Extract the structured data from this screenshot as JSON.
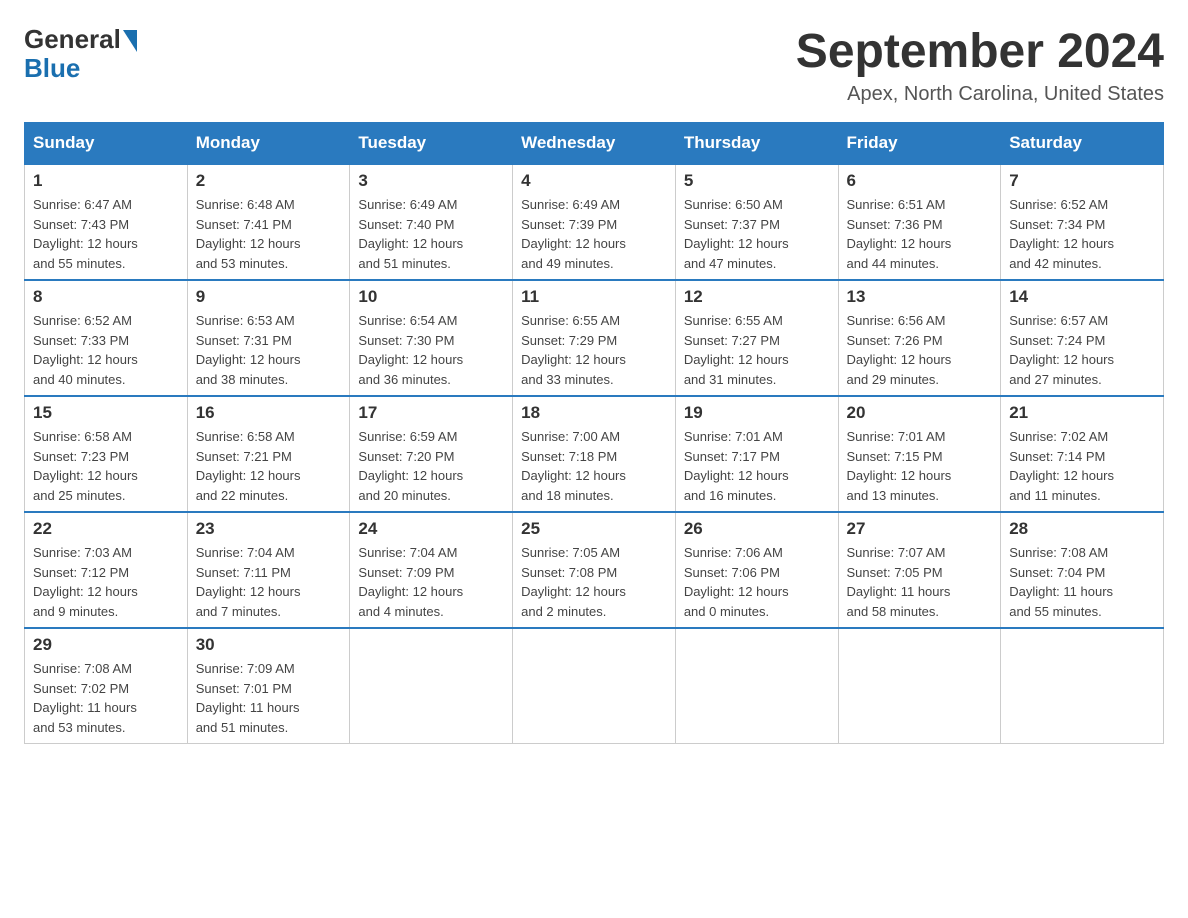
{
  "header": {
    "logo_general": "General",
    "logo_blue": "Blue",
    "month": "September 2024",
    "location": "Apex, North Carolina, United States"
  },
  "days_of_week": [
    "Sunday",
    "Monday",
    "Tuesday",
    "Wednesday",
    "Thursday",
    "Friday",
    "Saturday"
  ],
  "weeks": [
    [
      {
        "day": "1",
        "sunrise": "6:47 AM",
        "sunset": "7:43 PM",
        "daylight": "12 hours and 55 minutes."
      },
      {
        "day": "2",
        "sunrise": "6:48 AM",
        "sunset": "7:41 PM",
        "daylight": "12 hours and 53 minutes."
      },
      {
        "day": "3",
        "sunrise": "6:49 AM",
        "sunset": "7:40 PM",
        "daylight": "12 hours and 51 minutes."
      },
      {
        "day": "4",
        "sunrise": "6:49 AM",
        "sunset": "7:39 PM",
        "daylight": "12 hours and 49 minutes."
      },
      {
        "day": "5",
        "sunrise": "6:50 AM",
        "sunset": "7:37 PM",
        "daylight": "12 hours and 47 minutes."
      },
      {
        "day": "6",
        "sunrise": "6:51 AM",
        "sunset": "7:36 PM",
        "daylight": "12 hours and 44 minutes."
      },
      {
        "day": "7",
        "sunrise": "6:52 AM",
        "sunset": "7:34 PM",
        "daylight": "12 hours and 42 minutes."
      }
    ],
    [
      {
        "day": "8",
        "sunrise": "6:52 AM",
        "sunset": "7:33 PM",
        "daylight": "12 hours and 40 minutes."
      },
      {
        "day": "9",
        "sunrise": "6:53 AM",
        "sunset": "7:31 PM",
        "daylight": "12 hours and 38 minutes."
      },
      {
        "day": "10",
        "sunrise": "6:54 AM",
        "sunset": "7:30 PM",
        "daylight": "12 hours and 36 minutes."
      },
      {
        "day": "11",
        "sunrise": "6:55 AM",
        "sunset": "7:29 PM",
        "daylight": "12 hours and 33 minutes."
      },
      {
        "day": "12",
        "sunrise": "6:55 AM",
        "sunset": "7:27 PM",
        "daylight": "12 hours and 31 minutes."
      },
      {
        "day": "13",
        "sunrise": "6:56 AM",
        "sunset": "7:26 PM",
        "daylight": "12 hours and 29 minutes."
      },
      {
        "day": "14",
        "sunrise": "6:57 AM",
        "sunset": "7:24 PM",
        "daylight": "12 hours and 27 minutes."
      }
    ],
    [
      {
        "day": "15",
        "sunrise": "6:58 AM",
        "sunset": "7:23 PM",
        "daylight": "12 hours and 25 minutes."
      },
      {
        "day": "16",
        "sunrise": "6:58 AM",
        "sunset": "7:21 PM",
        "daylight": "12 hours and 22 minutes."
      },
      {
        "day": "17",
        "sunrise": "6:59 AM",
        "sunset": "7:20 PM",
        "daylight": "12 hours and 20 minutes."
      },
      {
        "day": "18",
        "sunrise": "7:00 AM",
        "sunset": "7:18 PM",
        "daylight": "12 hours and 18 minutes."
      },
      {
        "day": "19",
        "sunrise": "7:01 AM",
        "sunset": "7:17 PM",
        "daylight": "12 hours and 16 minutes."
      },
      {
        "day": "20",
        "sunrise": "7:01 AM",
        "sunset": "7:15 PM",
        "daylight": "12 hours and 13 minutes."
      },
      {
        "day": "21",
        "sunrise": "7:02 AM",
        "sunset": "7:14 PM",
        "daylight": "12 hours and 11 minutes."
      }
    ],
    [
      {
        "day": "22",
        "sunrise": "7:03 AM",
        "sunset": "7:12 PM",
        "daylight": "12 hours and 9 minutes."
      },
      {
        "day": "23",
        "sunrise": "7:04 AM",
        "sunset": "7:11 PM",
        "daylight": "12 hours and 7 minutes."
      },
      {
        "day": "24",
        "sunrise": "7:04 AM",
        "sunset": "7:09 PM",
        "daylight": "12 hours and 4 minutes."
      },
      {
        "day": "25",
        "sunrise": "7:05 AM",
        "sunset": "7:08 PM",
        "daylight": "12 hours and 2 minutes."
      },
      {
        "day": "26",
        "sunrise": "7:06 AM",
        "sunset": "7:06 PM",
        "daylight": "12 hours and 0 minutes."
      },
      {
        "day": "27",
        "sunrise": "7:07 AM",
        "sunset": "7:05 PM",
        "daylight": "11 hours and 58 minutes."
      },
      {
        "day": "28",
        "sunrise": "7:08 AM",
        "sunset": "7:04 PM",
        "daylight": "11 hours and 55 minutes."
      }
    ],
    [
      {
        "day": "29",
        "sunrise": "7:08 AM",
        "sunset": "7:02 PM",
        "daylight": "11 hours and 53 minutes."
      },
      {
        "day": "30",
        "sunrise": "7:09 AM",
        "sunset": "7:01 PM",
        "daylight": "11 hours and 51 minutes."
      },
      null,
      null,
      null,
      null,
      null
    ]
  ],
  "labels": {
    "sunrise": "Sunrise:",
    "sunset": "Sunset:",
    "daylight": "Daylight:"
  }
}
